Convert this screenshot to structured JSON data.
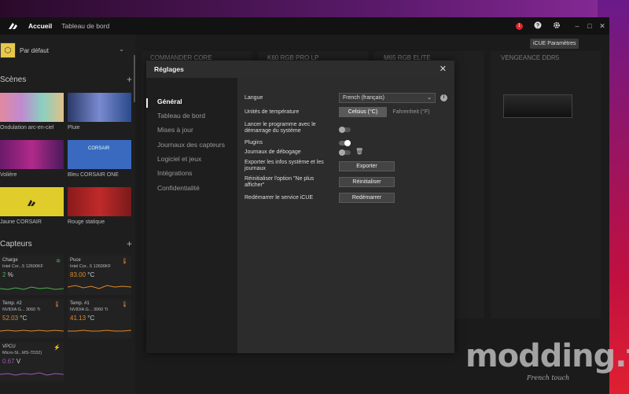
{
  "titlebar": {
    "nav": [
      "Accueil",
      "Tableau de bord"
    ],
    "notification_count": "1",
    "tooltip": "iCUE Paramètres"
  },
  "sidebar": {
    "profile": "Par défaut",
    "scenes_title": "Scènes",
    "scenes": [
      {
        "label": "Ondulation arc-en-ciel"
      },
      {
        "label": "Pluie"
      },
      {
        "label": "Volière"
      },
      {
        "label": "Bleu CORSAIR ONE"
      },
      {
        "label": "Jaune CORSAIR"
      },
      {
        "label": "Rouge statique"
      }
    ],
    "sensors_title": "Capteurs",
    "sensors": [
      {
        "name": "Charge",
        "device": "Intel Cor...5 12600KF",
        "value": "2",
        "unit": "%",
        "color": "#4caf50"
      },
      {
        "name": "Puce",
        "device": "Intel Cor...5 12600KF",
        "value": "83.00",
        "unit": "°C",
        "color": "#e0862a"
      },
      {
        "name": "Temp. #2",
        "device": "NVIDIA G... 3060 Ti",
        "value": "52.03",
        "unit": "°C",
        "color": "#e0862a"
      },
      {
        "name": "Temp. #1",
        "device": "NVIDIA G... 3060 Ti",
        "value": "41.13",
        "unit": "°C",
        "color": "#e0862a"
      },
      {
        "name": "VPCU",
        "device": "Micro-St...MS-7D32)",
        "value": "0.67",
        "unit": "V",
        "color": "#9b59b6"
      }
    ]
  },
  "devices": [
    "COMMANDER CORE",
    "K60 RGB PRO LP",
    "M65 RGB ELITE",
    "VENGEANCE DDR5"
  ],
  "modal": {
    "title": "Réglages",
    "nav": [
      "Général",
      "Tableau de bord",
      "Mises à jour",
      "Journaux des capteurs",
      "Logiciel et jeux",
      "Intégrations",
      "Confidentialité"
    ],
    "language_label": "Langue",
    "language_value": "French (français)",
    "temp_label": "Unités de température",
    "temp_celsius": "Celsius (°C)",
    "temp_fahrenheit": "Fahrenheit (°F)",
    "startup_label": "Lancer le programme avec le démarrage du système",
    "plugins_label": "Plugins",
    "debug_label": "Journaux de débogage",
    "export_label": "Exporter les infos système et les journaux",
    "export_button": "Exporter",
    "reset_label": "Réinitialiser l'option \"Ne plus afficher\"",
    "reset_button": "Réinitialiser",
    "restart_label": "Redémarrer le service iCUE",
    "restart_button": "Redémarrer"
  },
  "watermark": {
    "main": "modding.fr",
    "sub": "French touch"
  }
}
